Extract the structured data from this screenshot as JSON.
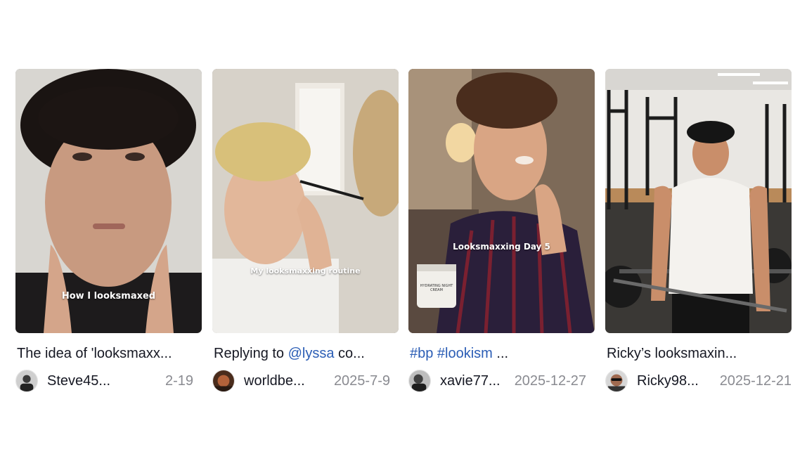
{
  "videos": [
    {
      "overlay_text": "How I looksmaxed",
      "caption_prefix": "The idea of 'looksmaxx...",
      "caption_tag": "",
      "caption_suffix": "",
      "author": "Steve45...",
      "date": "2-19",
      "thumbnail_icon": "man-hands-on-face-thumbnail"
    },
    {
      "overlay_text": "My looksmaxxing routine",
      "caption_prefix": "Replying to ",
      "caption_tag": "@lyssa",
      "caption_suffix": " co...",
      "author": "worldbe...",
      "date": "2025-7-9",
      "thumbnail_icon": "man-grooming-eyebrows-thumbnail"
    },
    {
      "overlay_text": "Looksmaxxing Day 5",
      "caption_prefix": "",
      "caption_tag": "#bp #lookism",
      "caption_suffix": " ...",
      "author": "xavie77...",
      "date": "2025-12-27",
      "thumbnail_icon": "man-applying-cream-thumbnail",
      "product_label": "HYDRATING NIGHT CREAM"
    },
    {
      "overlay_text": "",
      "caption_prefix": "Ricky’s looksmaxin...",
      "caption_tag": "",
      "caption_suffix": "",
      "author": "Ricky98...",
      "date": "2025-12-21",
      "thumbnail_icon": "man-in-gym-thumbnail"
    }
  ],
  "colors": {
    "link": "#2b5db5",
    "date": "#8a8b91",
    "text": "#161823"
  }
}
